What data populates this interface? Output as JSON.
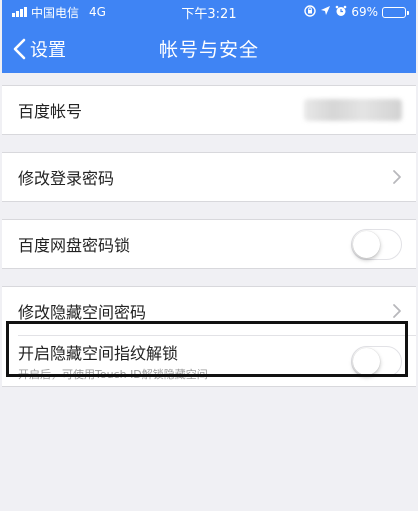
{
  "status_bar": {
    "carrier": "中国电信",
    "network": "4G",
    "time": "下午3:21",
    "battery": "69%",
    "battery_level": 0.69
  },
  "nav": {
    "back_label": "设置",
    "title": "帐号与安全"
  },
  "rows": {
    "account_label": "百度帐号",
    "change_login_password": "修改登录密码",
    "netdisk_lock": "百度网盘密码锁",
    "change_hidden_password": "修改隐藏空间密码",
    "fingerprint_unlock": "开启隐藏空间指纹解锁",
    "fingerprint_sub": "开启后，可使用Touch ID解锁隐藏空间"
  },
  "toggles": {
    "netdisk_lock": false,
    "fingerprint_unlock": false
  },
  "colors": {
    "header": "#3f84f4",
    "background": "#f0f0f4"
  }
}
